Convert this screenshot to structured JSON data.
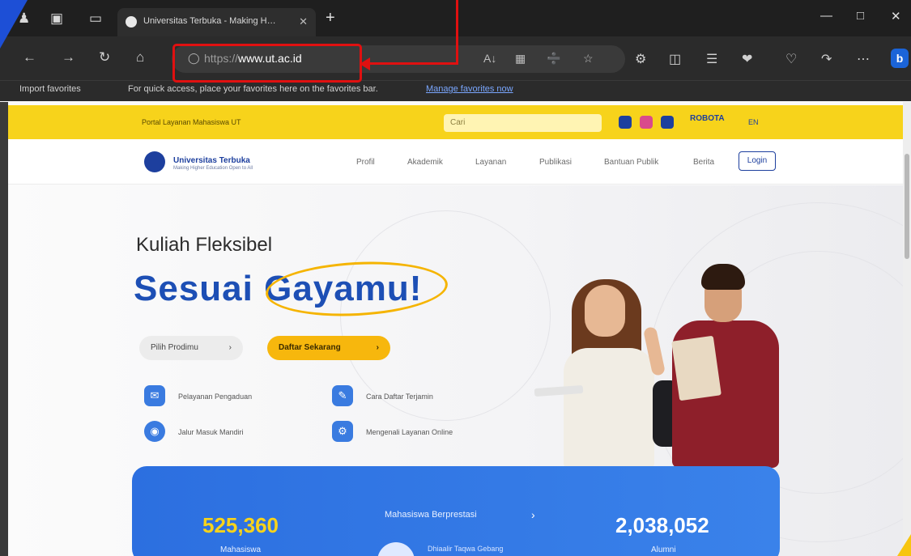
{
  "browser": {
    "tab_title": "Universitas Terbuka - Making H…",
    "url_prefix": "https://",
    "url_host": "www.ut.ac.id",
    "favorites_import": "Import favorites",
    "favorites_message": "For quick access, place your favorites here on the favorites bar.",
    "favorites_manage_link": "Manage favorites now"
  },
  "site": {
    "top_strip_link": "Portal Layanan Mahasiswa UT",
    "search_placeholder": "Cari",
    "strip_badge": "ROBOTA",
    "lang": "EN",
    "logo_name": "Universitas Terbuka",
    "logo_tagline": "Making Higher Education Open to All",
    "menu": [
      "Profil",
      "Akademik",
      "Layanan",
      "Publikasi",
      "Bantuan Publik",
      "Berita"
    ],
    "login": "Login"
  },
  "hero": {
    "subtitle": "Kuliah Fleksibel",
    "title_part1": "Sesuai ",
    "title_part2": "Gayamu!",
    "btn_program": "Pilih Prodimu",
    "btn_register": "Daftar Sekarang",
    "features": [
      "Pelayanan Pengaduan",
      "Cara Daftar Terjamin",
      "Jalur Masuk Mandiri",
      "Mengenali Layanan Online"
    ]
  },
  "stats": {
    "left_number": "525,360",
    "left_label": "Mahasiswa",
    "middle_label": "Mahasiswa Berprestasi",
    "middle_sub": "Dhiaalir Taqwa Gebang",
    "right_number": "2,038,052",
    "right_label": "Alumni"
  }
}
